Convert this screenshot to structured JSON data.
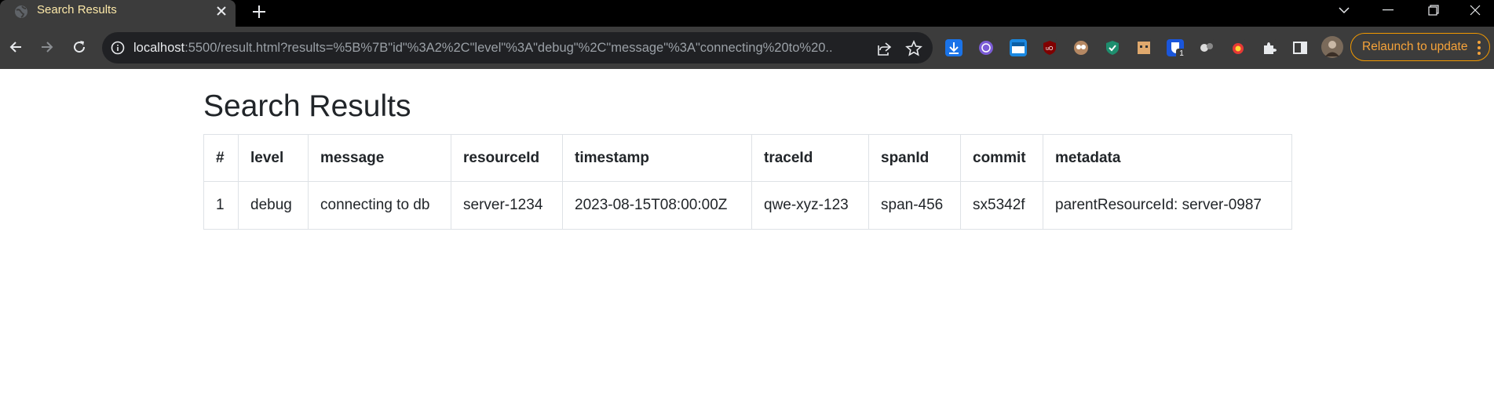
{
  "browser": {
    "tab": {
      "title": "Search Results",
      "favicon": "globe-icon"
    },
    "address_bar": {
      "url_host": "localhost",
      "url_rest": ":5500/result.html?results=%5B%7B\"id\"%3A2%2C\"level\"%3A\"debug\"%2C\"message\"%3A\"connecting%20to%20..."
    },
    "relaunch_label": "Relaunch to update",
    "extension_badge": "1",
    "colors": {
      "frame": "#000000",
      "toolbar": "#3c3c3c",
      "omnibox": "#202124",
      "relaunch": "#f29900"
    }
  },
  "page": {
    "title": "Search Results",
    "table": {
      "headers": [
        "#",
        "level",
        "message",
        "resourceId",
        "timestamp",
        "traceId",
        "spanId",
        "commit",
        "metadata"
      ],
      "rows": [
        [
          "1",
          "debug",
          "connecting to db",
          "server-1234",
          "2023-08-15T08:00:00Z",
          "qwe-xyz-123",
          "span-456",
          "sx5342f",
          "parentResourceId: server-0987"
        ]
      ]
    }
  }
}
